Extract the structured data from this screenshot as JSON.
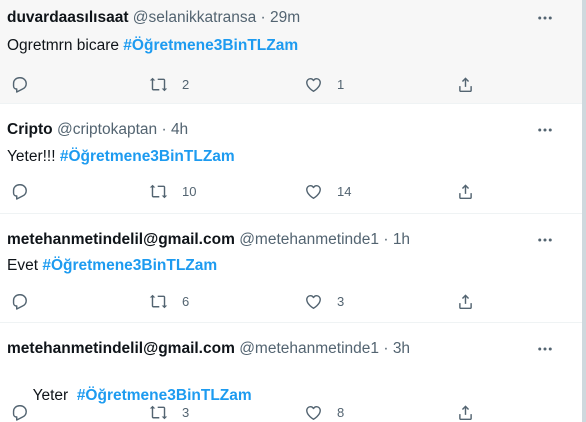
{
  "tweets": [
    {
      "name": "duvardaasılısaat",
      "handle": "@selanikkatransa",
      "separator": "·",
      "time": "29m",
      "text": "Ogretmrn bicare ",
      "hashtag": "#Öğretmene3BinTLZam",
      "replies": "",
      "retweets": "2",
      "likes": "1",
      "hovered": true
    },
    {
      "name": "Cripto",
      "handle": "@criptokaptan",
      "separator": "·",
      "time": "4h",
      "text": "Yeter!!! ",
      "hashtag": "#Öğretmene3BinTLZam",
      "replies": "",
      "retweets": "10",
      "likes": "14",
      "hovered": false
    },
    {
      "name": "metehanmetindelil@gmail.com",
      "handle": "@metehanmetinde1",
      "separator": "·",
      "time": "1h",
      "text": "Evet ",
      "hashtag": "#Öğretmene3BinTLZam",
      "replies": "",
      "retweets": "6",
      "likes": "3",
      "hovered": false
    },
    {
      "name": "metehanmetindelil@gmail.com",
      "handle": "@metehanmetinde1",
      "separator": "·",
      "time": "3h",
      "text": "Yeter  ",
      "hashtag": "#Öğretmene3BinTLZam",
      "replies": "",
      "retweets": "3",
      "likes": "8",
      "hovered": false
    }
  ],
  "icons": {
    "reply": "reply-icon",
    "retweet": "retweet-icon",
    "like": "heart-icon",
    "share": "share-icon",
    "more": "more-options-icon"
  },
  "colors": {
    "hashtag": "#1d9bf0",
    "secondary_text": "#536471",
    "hover_background": "#f7f7f7"
  }
}
